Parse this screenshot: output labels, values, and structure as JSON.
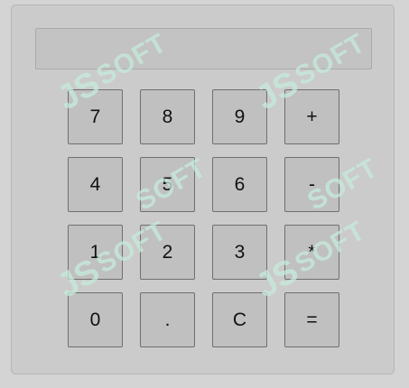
{
  "display": {
    "value": ""
  },
  "keys": [
    {
      "label": "7",
      "name": "key-7"
    },
    {
      "label": "8",
      "name": "key-8"
    },
    {
      "label": "9",
      "name": "key-9"
    },
    {
      "label": "+",
      "name": "key-plus"
    },
    {
      "label": "4",
      "name": "key-4"
    },
    {
      "label": "5",
      "name": "key-5"
    },
    {
      "label": "6",
      "name": "key-6"
    },
    {
      "label": "-",
      "name": "key-minus"
    },
    {
      "label": "1",
      "name": "key-1"
    },
    {
      "label": "2",
      "name": "key-2"
    },
    {
      "label": "3",
      "name": "key-3"
    },
    {
      "label": "*",
      "name": "key-multiply"
    },
    {
      "label": "0",
      "name": "key-0"
    },
    {
      "label": ".",
      "name": "key-decimal"
    },
    {
      "label": "C",
      "name": "key-clear"
    },
    {
      "label": "=",
      "name": "key-equals"
    }
  ],
  "watermark": {
    "mark": "JS",
    "text": "SOFT",
    "color": "#c6ecdc"
  }
}
